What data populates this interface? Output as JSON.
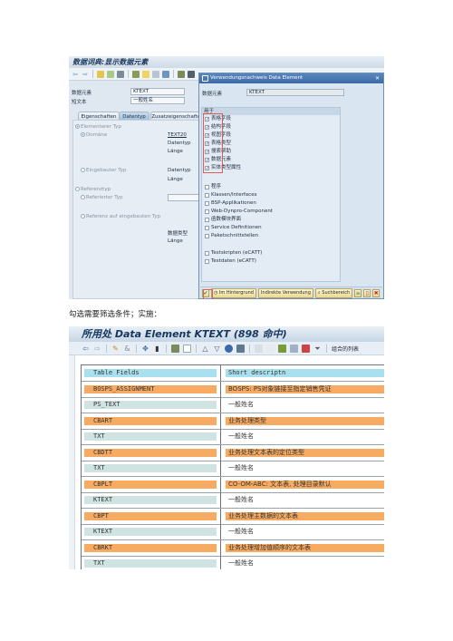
{
  "screen1": {
    "window_title": "数据词典:显示数据元素",
    "fields": {
      "data_element_label": "数据元素",
      "data_element_value": "KTEXT",
      "short_text_label": "短文本",
      "short_text_value": "一般姓名"
    },
    "tabs": [
      {
        "label": "Eigenschaften",
        "active": false
      },
      {
        "label": "Datentyp",
        "active": true
      },
      {
        "label": "Zusatzeigenschaften",
        "active": false
      }
    ],
    "panel": {
      "elementary_type": "Elementarer Typ",
      "domain": "Domäne",
      "domain_value": "TEXT20",
      "datatype_label": "Datentyp",
      "length_label": "Länge",
      "builtin_type": "Eingebauter Typ",
      "datatype_label2": "Datentyp",
      "length_label2": "Länge",
      "reference_type": "Referenztyp",
      "referenced_type": "Referierter Typ",
      "ref_builtin_type": "Referenz auf eingebauten Typ",
      "data_type_cn": "数据类型",
      "length_label3": "Länge"
    },
    "dialog": {
      "title": "Verwendungsnachweis Data Element",
      "data_element_label": "数据元素",
      "data_element_value": "KTEXT",
      "group_title": "用于",
      "checked_items": [
        {
          "label": "表格字段",
          "checked": true
        },
        {
          "label": "结构字段",
          "checked": true
        },
        {
          "label": "视图字段",
          "checked": true
        },
        {
          "label": "表格类型",
          "checked": true
        },
        {
          "label": "搜索帮助",
          "checked": true
        },
        {
          "label": "数据元素",
          "checked": true
        },
        {
          "label": "实体类型属性",
          "checked": true
        }
      ],
      "other_items": [
        {
          "label": "程序",
          "checked": false
        },
        {
          "label": "Klassen/Interfaces",
          "checked": false
        },
        {
          "label": "BSP-Applikationen",
          "checked": false
        },
        {
          "label": "Web-Dynpro-Component",
          "checked": false
        },
        {
          "label": "函数模块界面",
          "checked": false
        },
        {
          "label": "Service Definitionen",
          "checked": false
        },
        {
          "label": "Paketschnittstellen",
          "checked": false
        }
      ],
      "ecatt_items": [
        {
          "label": "Testskripten (eCATT)",
          "checked": false
        },
        {
          "label": "Testdaten (eCATT)",
          "checked": false
        }
      ],
      "buttons": {
        "background": "Im Hintergrund",
        "indirect": "Indirekte Verwendung",
        "search_area": "Suchbereich"
      }
    }
  },
  "caption": "勾选需要筛选条件；实施：",
  "screen2": {
    "title": "所用处 Data Element KTEXT (898 命中)",
    "toolbar_text": "组合的列表",
    "columns": [
      "Table Fields",
      "Short descriptn"
    ],
    "rows": [
      {
        "field": "BOSPS_ASSIGNMENT",
        "desc": "BOSPS: PS对象链接至指定销售凭证",
        "type": "table",
        "checkbox": false
      },
      {
        "field": "PS_TEXT",
        "desc": "一般姓名",
        "type": "field",
        "checkbox": true,
        "selected": true
      },
      {
        "field": "CBART",
        "desc": "业务处理类型",
        "type": "table",
        "checkbox": false
      },
      {
        "field": "TXT",
        "desc": "一般姓名",
        "type": "field",
        "checkbox": true
      },
      {
        "field": "CBDTT",
        "desc": "业务处理文本表的定位类型",
        "type": "table",
        "checkbox": false
      },
      {
        "field": "TXT",
        "desc": "一般姓名",
        "type": "field",
        "checkbox": true
      },
      {
        "field": "CBPLT",
        "desc": "CO-OM-ABC: 文本表, 处理目录默认",
        "type": "table",
        "checkbox": false
      },
      {
        "field": "KTEXT",
        "desc": "一般姓名",
        "type": "field",
        "checkbox": true
      },
      {
        "field": "CBPT",
        "desc": "业务处理主数据的文本表",
        "type": "table",
        "checkbox": false
      },
      {
        "field": "KTEXT",
        "desc": "一般姓名",
        "type": "field",
        "checkbox": true
      },
      {
        "field": "CBRKT",
        "desc": "业务处理增加值顺序的文本表",
        "type": "table",
        "checkbox": false
      },
      {
        "field": "TXT",
        "desc": "一般姓名",
        "type": "field",
        "checkbox": true
      }
    ]
  },
  "colors": {
    "table_row": "#f7ab62",
    "field_row": "#cfe4e2",
    "header": "#a9e0f0",
    "highlight": "#e05a5a"
  }
}
